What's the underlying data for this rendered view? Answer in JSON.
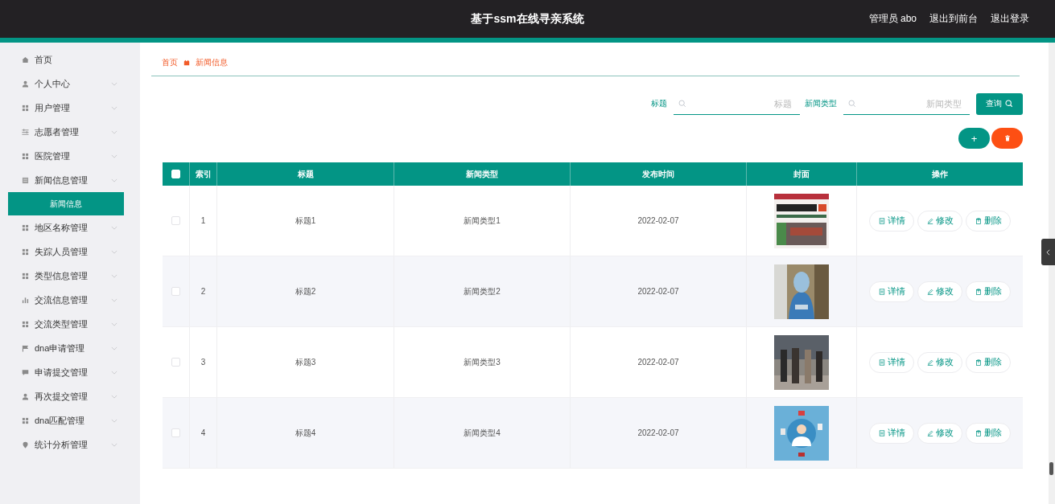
{
  "top_bar": {
    "title": "基于ssm在线寻亲系统",
    "user": "管理员 abo",
    "links": [
      "退出到前台",
      "退出登录"
    ]
  },
  "sidebar": {
    "items": [
      {
        "label": "首页",
        "kind": "link"
      },
      {
        "label": "个人中心",
        "kind": "menu"
      },
      {
        "label": "用户管理",
        "kind": "menu"
      },
      {
        "label": "志愿者管理",
        "kind": "menu"
      },
      {
        "label": "医院管理",
        "kind": "menu"
      },
      {
        "label": "新闻信息管理",
        "kind": "menu",
        "children": [
          {
            "label": "新闻信息",
            "selected": true
          }
        ]
      },
      {
        "label": "地区名称管理",
        "kind": "menu"
      },
      {
        "label": "失踪人员管理",
        "kind": "menu"
      },
      {
        "label": "类型信息管理",
        "kind": "menu"
      },
      {
        "label": "交流信息管理",
        "kind": "menu"
      },
      {
        "label": "交流类型管理",
        "kind": "menu"
      },
      {
        "label": "dna申请管理",
        "kind": "menu"
      },
      {
        "label": "申请提交管理",
        "kind": "menu"
      },
      {
        "label": "再次提交管理",
        "kind": "menu"
      },
      {
        "label": "dna匹配管理",
        "kind": "menu"
      },
      {
        "label": "统计分析管理",
        "kind": "menu"
      }
    ]
  },
  "breadcrumb": [
    "首页",
    "新闻信息"
  ],
  "search": {
    "fields": [
      {
        "label": "标题",
        "placeholder": "标题"
      },
      {
        "label": "新闻类型",
        "placeholder": "新闻类型"
      }
    ],
    "button": "查询"
  },
  "add_button": "+",
  "table": {
    "header_checked": false,
    "columns": [
      "索引",
      "标题",
      "新闻类型",
      "发布时间",
      "封面",
      "操作"
    ],
    "rows": [
      {
        "index": "1",
        "title": "标题1",
        "type": "新闻类型1",
        "date": "2022-02-07",
        "checked": false,
        "actions": [
          "详情",
          "修改",
          "删除"
        ]
      },
      {
        "index": "2",
        "title": "标题2",
        "type": "新闻类型2",
        "date": "2022-02-07",
        "checked": false,
        "actions": [
          "详情",
          "修改",
          "删除"
        ]
      },
      {
        "index": "3",
        "title": "标题3",
        "type": "新闻类型3",
        "date": "2022-02-07",
        "checked": false,
        "actions": [
          "详情",
          "修改",
          "删除"
        ]
      },
      {
        "index": "4",
        "title": "标题4",
        "type": "新闻类型4",
        "date": "2022-02-07",
        "checked": false,
        "actions": [
          "详情",
          "修改",
          "删除"
        ]
      }
    ]
  }
}
